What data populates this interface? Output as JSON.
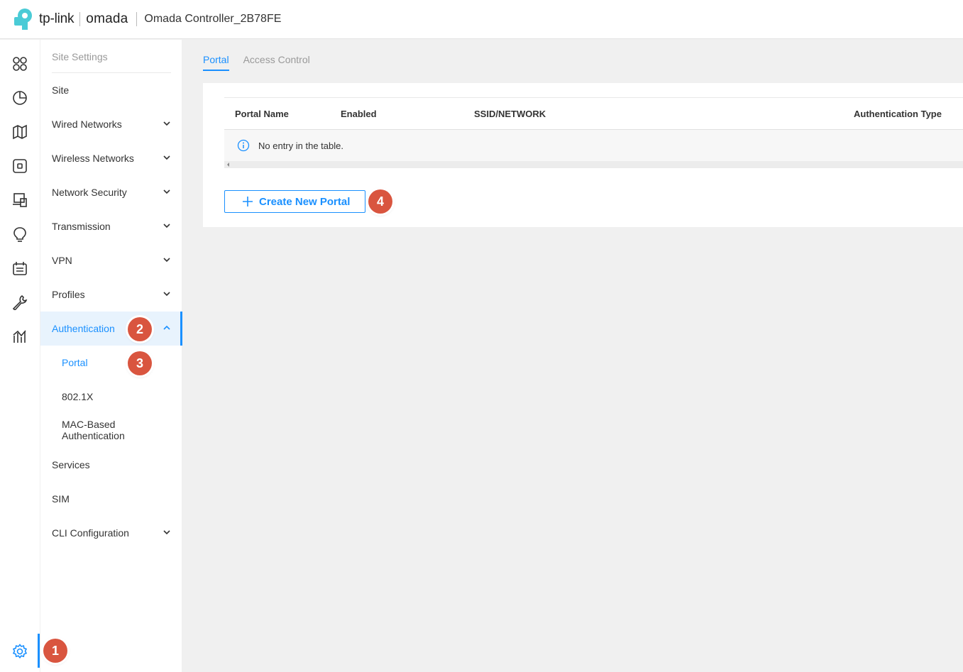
{
  "header": {
    "brand": "tp-link",
    "product": "omada",
    "controller_name": "Omada Controller_2B78FE"
  },
  "rail": {
    "icons": [
      "dashboard-icon",
      "statistics-icon",
      "map-icon",
      "devices-icon",
      "clients-icon",
      "insight-icon",
      "logs-icon",
      "tools-icon",
      "reports-icon"
    ],
    "settings_icon": "settings-gear-icon"
  },
  "nav": {
    "title": "Site Settings",
    "items": [
      {
        "label": "Site",
        "expandable": false
      },
      {
        "label": "Wired Networks",
        "expandable": true
      },
      {
        "label": "Wireless Networks",
        "expandable": true
      },
      {
        "label": "Network Security",
        "expandable": true
      },
      {
        "label": "Transmission",
        "expandable": true
      },
      {
        "label": "VPN",
        "expandable": true
      },
      {
        "label": "Profiles",
        "expandable": true
      },
      {
        "label": "Authentication",
        "expandable": true,
        "expanded": true,
        "active": true
      },
      {
        "label": "Services",
        "expandable": false
      },
      {
        "label": "SIM",
        "expandable": false
      },
      {
        "label": "CLI Configuration",
        "expandable": true
      }
    ],
    "authentication_sub": [
      {
        "label": "Portal",
        "selected": true
      },
      {
        "label": "802.1X"
      },
      {
        "label_line1": "MAC-Based",
        "label_line2": "Authentication"
      }
    ]
  },
  "tabs": [
    {
      "label": "Portal",
      "active": true
    },
    {
      "label": "Access Control",
      "active": false
    }
  ],
  "table": {
    "columns": [
      "Portal Name",
      "Enabled",
      "SSID/NETWORK",
      "Authentication Type"
    ],
    "empty_message": "No entry in the table."
  },
  "create_button_label": "Create New Portal",
  "steps": [
    "1",
    "2",
    "3",
    "4"
  ],
  "colors": {
    "accent": "#1a90ff",
    "badge": "#d9553f",
    "tplink_teal": "#4acbd6"
  }
}
